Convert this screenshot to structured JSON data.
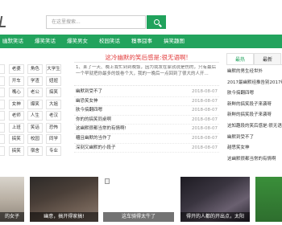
{
  "search": {
    "placeholder": "在这里搜索..."
  },
  "nav": [
    "幽默笑话",
    "爆笑笑话",
    "爆笑男女",
    "校园笑话",
    "糗事囧事",
    "搞笑趣图"
  ],
  "tags": [
    [
      "",
      "老婆",
      "角色",
      "大学生"
    ],
    [
      "",
      "开车",
      "学渣",
      "妞妞"
    ],
    [
      "",
      "嘴心",
      "老公",
      "搞笑"
    ],
    [
      "",
      "女神",
      "爆笑",
      "大姐"
    ],
    [
      "",
      "老师",
      "人生",
      "老汉"
    ],
    [
      "",
      "上班",
      "笑话",
      "恐怖"
    ],
    [
      "",
      "搞笑",
      "校园",
      "同学"
    ],
    [
      "",
      "搞笑",
      "宿舍",
      "专业"
    ]
  ],
  "center": {
    "title": "这冷幽默的笑后感是:很无语啊!",
    "intro": "1、某了一天、晚上我忙到到晚饭，因为我发在家就说是伤的，只有最后一个早就把你最多的饭卷个大，我的一晚后一点回到了很大的人开...",
    "items": [
      {
        "title": "幽默到受不了",
        "date": "2018-08-07"
      },
      {
        "title": "幽恐笑女神",
        "date": "2018-08-07"
      },
      {
        "title": "肤今搞翻四嗯",
        "date": "2018-08-07"
      },
      {
        "title": "你的的搞笑同桌啊",
        "date": "2018-08-07"
      },
      {
        "title": "这幽默很都当常的有情啊!",
        "date": "2018-08-07"
      },
      {
        "title": "糟且幽默的当作了",
        "date": "2018-08-07"
      },
      {
        "title": "深刻又幽默的小段子",
        "date": "2018-08-07"
      }
    ]
  },
  "right": {
    "tabs": [
      "最热",
      "最新"
    ],
    "items": [
      "幽默的男生经世外",
      "2017最幽默经推告别2017绝",
      "肤今搞翻四嗯",
      "新鲜的搞笑段子来袭呀",
      "新鲜的搞笑段子来袭呀",
      "这知趣段的笑后感是:很无语",
      "幽默到受不了",
      "越思笑女神",
      "这幽默很都当常的有情啊"
    ]
  },
  "thumbs": [
    {
      "caption": "的女子"
    },
    {
      "caption": "幽意，搞开得家搞!"
    },
    {
      "caption": "这车骑得太牛了"
    },
    {
      "caption": "得开的人都的开出点，太阳"
    },
    {
      "caption": ""
    }
  ],
  "colors": {
    "brand": "#22a35d",
    "headline": "#e23b3b"
  },
  "icons": {
    "search": "magnifier-icon",
    "logo": "logo-mark"
  }
}
